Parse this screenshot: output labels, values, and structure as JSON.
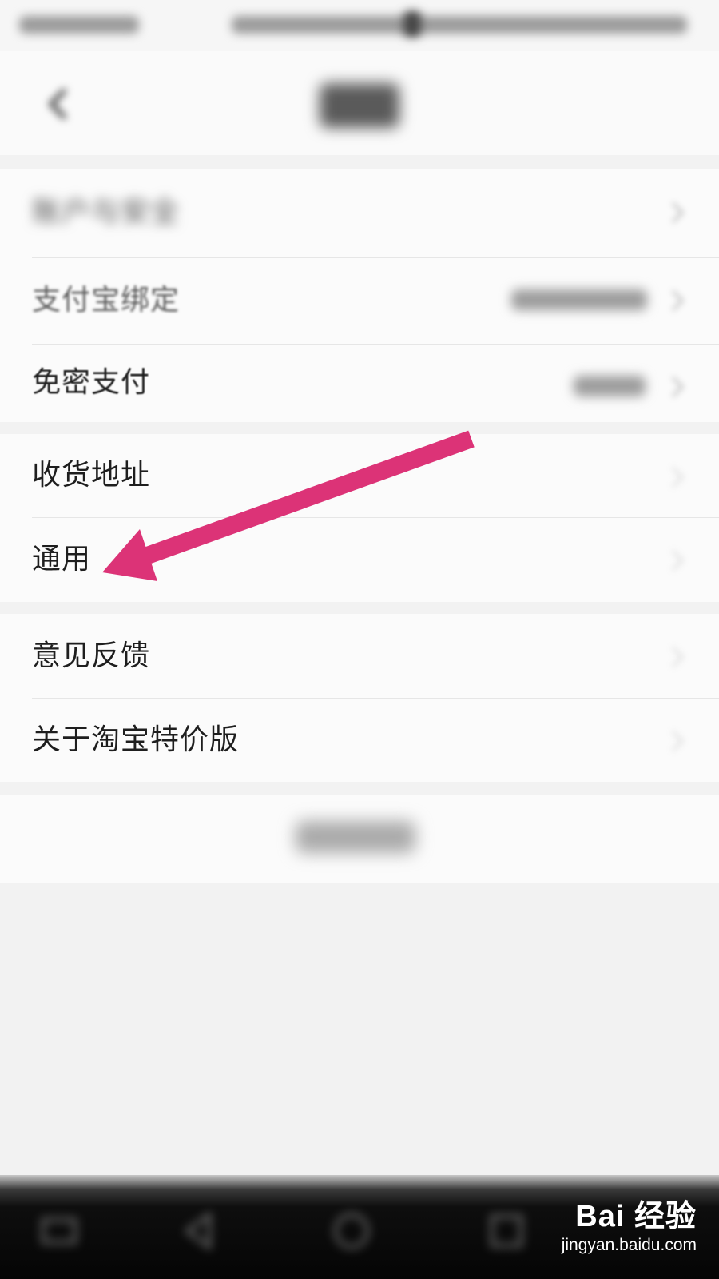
{
  "screen": {
    "title": "设置",
    "accent_arrow_color": "#dc3377"
  },
  "settings_groups": [
    {
      "items": [
        {
          "label": "账户与安全",
          "value": ""
        },
        {
          "label": "支付宝绑定",
          "value": ""
        },
        {
          "label": "免密支付",
          "value": ""
        }
      ]
    },
    {
      "items": [
        {
          "label": "收货地址",
          "value": ""
        },
        {
          "label": "通用",
          "value": ""
        }
      ]
    },
    {
      "items": [
        {
          "label": "意见反馈",
          "value": ""
        },
        {
          "label": "关于淘宝特价版",
          "value": ""
        }
      ]
    }
  ],
  "logout_label": "退出登录",
  "watermark": {
    "logo_text": "Bai 经验",
    "url": "jingyan.baidu.com"
  }
}
